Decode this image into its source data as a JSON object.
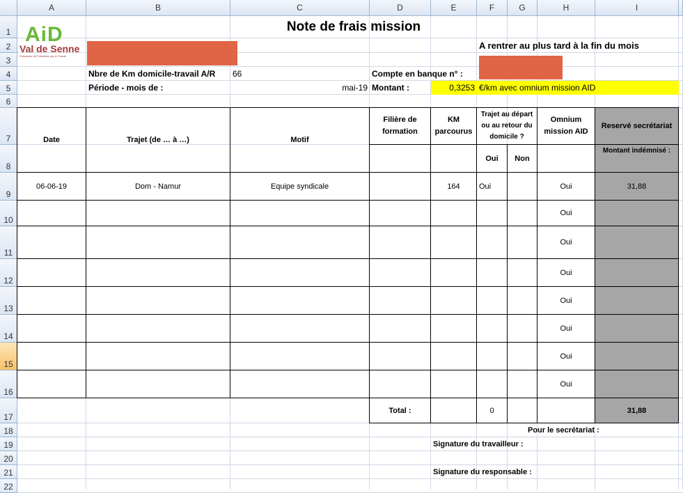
{
  "columns": [
    "A",
    "B",
    "C",
    "D",
    "E",
    "F",
    "G",
    "H",
    "I"
  ],
  "rows": [
    "1",
    "2",
    "3",
    "4",
    "5",
    "6",
    "7",
    "8",
    "9",
    "10",
    "11",
    "12",
    "13",
    "14",
    "15",
    "16",
    "17",
    "18",
    "19",
    "20",
    "21",
    "22"
  ],
  "selected_row": "15",
  "logo": {
    "text": "AiD",
    "subtitle": "Val de Senne",
    "tagline": "Entreprise de Formation par le Travail"
  },
  "title": "Note de frais mission",
  "deadline": "A rentrer au plus tard à la fin du mois",
  "km_label": "Nbre de Km domicile-travail A/R",
  "km_value": "66",
  "bank_label": "Compte en banque n° :",
  "period_label": "Période - mois de :",
  "period_value": "mai-19",
  "amount_label": "Montant :",
  "rate": "0,3253",
  "rate_desc": "€/km avec omnium mission AID",
  "colors": {
    "redact": "#e06446",
    "yellow": "#ffff00",
    "gray": "#a6a6a6"
  },
  "headers": {
    "date": "Date",
    "trajet": "Trajet (de … à …)",
    "motif": "Motif",
    "filiere": "Filière de formation",
    "km": "KM parcourus",
    "depart": "Trajet au départ ou au retour du domicile ?",
    "oui": "Oui",
    "non": "Non",
    "omnium": "Omnium mission AID",
    "reserve": "Reservé secrétariat",
    "montant": "Montant indémnisé :"
  },
  "entries": [
    {
      "date": "06-06-19",
      "trajet": "Dom - Namur",
      "motif": "Equipe syndicale",
      "filiere": "",
      "km": "164",
      "oui": "Oui",
      "non": "",
      "omnium": "Oui",
      "montant": "31,88"
    },
    {
      "date": "",
      "trajet": "",
      "motif": "",
      "filiere": "",
      "km": "",
      "oui": "",
      "non": "",
      "omnium": "Oui",
      "montant": ""
    },
    {
      "date": "",
      "trajet": "",
      "motif": "",
      "filiere": "",
      "km": "",
      "oui": "",
      "non": "",
      "omnium": "Oui",
      "montant": ""
    },
    {
      "date": "",
      "trajet": "",
      "motif": "",
      "filiere": "",
      "km": "",
      "oui": "",
      "non": "",
      "omnium": "Oui",
      "montant": ""
    },
    {
      "date": "",
      "trajet": "",
      "motif": "",
      "filiere": "",
      "km": "",
      "oui": "",
      "non": "",
      "omnium": "Oui",
      "montant": ""
    },
    {
      "date": "",
      "trajet": "",
      "motif": "",
      "filiere": "",
      "km": "",
      "oui": "",
      "non": "",
      "omnium": "Oui",
      "montant": ""
    },
    {
      "date": "",
      "trajet": "",
      "motif": "",
      "filiere": "",
      "km": "",
      "oui": "",
      "non": "",
      "omnium": "Oui",
      "montant": ""
    },
    {
      "date": "",
      "trajet": "",
      "motif": "",
      "filiere": "",
      "km": "",
      "oui": "",
      "non": "",
      "omnium": "Oui",
      "montant": ""
    }
  ],
  "total_label": "Total :",
  "total_oui": "0",
  "total_montant": "31,88",
  "secretariat": "Pour le secrétariat :",
  "sig_worker": "Signature du travailleur :",
  "sig_manager": "Signature du responsable :"
}
